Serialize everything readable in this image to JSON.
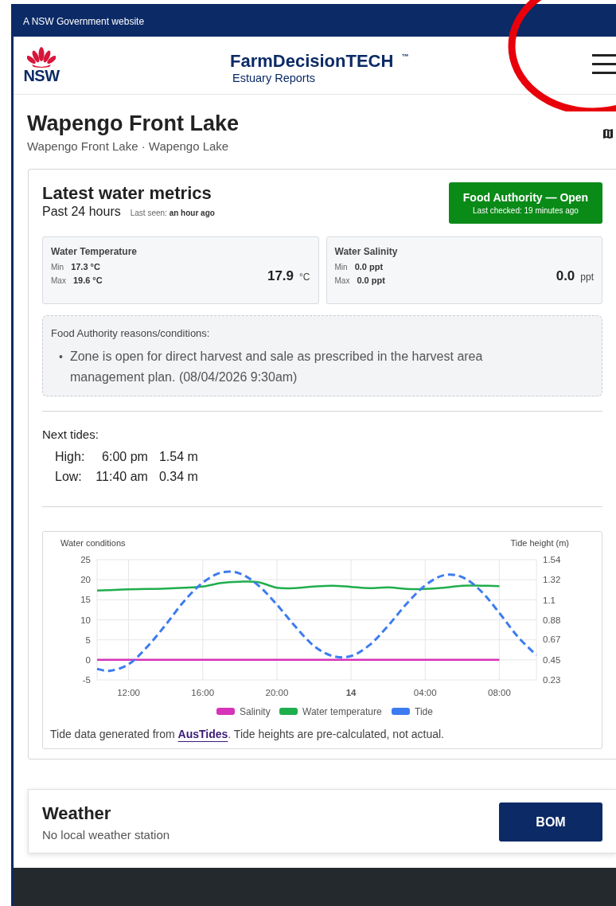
{
  "gov_bar": {
    "text": "A NSW Government website"
  },
  "header": {
    "logo_text": "NSW",
    "title": "FarmDecisionTECH $^{™}$",
    "subtitle": "Estuary Reports"
  },
  "location": {
    "title": "Wapengo Front Lake",
    "subtitle": "Wapengo Front Lake · Wapengo Lake"
  },
  "metrics_card": {
    "title": "Latest water metrics",
    "period": "Past 24 hours",
    "last_seen": "Last seen: **an hour ago**",
    "status": {
      "title": "Food Authority — Open",
      "checked": "Last checked: 19 minutes ago",
      "open": true
    },
    "metrics": [
      {
        "label": "Water Temperature",
        "min_label": "Min",
        "min": "17.3 °C",
        "max_label": "Max",
        "max": "19.6 °C",
        "value": "17.9",
        "unit": "°C"
      },
      {
        "label": "Water Salinity",
        "min_label": "Min",
        "min": "0.0 ppt",
        "max_label": "Max",
        "max": "0.0 ppt",
        "value": "0.0",
        "unit": "ppt"
      }
    ],
    "reasons": {
      "title": "Food Authority reasons/conditions:",
      "bullet": "•",
      "items": [
        "Zone is open for direct harvest and sale as prescribed in the harvest area management plan. (08/04/2026 9:30am)"
      ]
    },
    "tides": {
      "title": "Next tides:",
      "rows": [
        {
          "label": "High:",
          "time": "6:00 pm",
          "height": "1.54 m"
        },
        {
          "label": "Low:",
          "time": "11:40 am",
          "height": "0.34 m"
        }
      ]
    },
    "chart": {
      "chart_data": {
        "type": "line",
        "ylabel": "Water conditions",
        "y2label": "Tide height (m)",
        "x": [
          "2026-04-13T10:18",
          "2026-04-13T11:00",
          "2026-04-13T12:00",
          "2026-04-13T13:00",
          "2026-04-13T14:00",
          "2026-04-13T15:00",
          "2026-04-13T16:00",
          "2026-04-13T17:00",
          "2026-04-13T18:00",
          "2026-04-13T19:00",
          "2026-04-13T20:00",
          "2026-04-13T21:00",
          "2026-04-13T22:00",
          "2026-04-13T23:00",
          "2026-04-14T00:00",
          "2026-04-14T01:00",
          "2026-04-14T02:00",
          "2026-04-14T03:00",
          "2026-04-14T04:00",
          "2026-04-14T05:00",
          "2026-04-14T06:00",
          "2026-04-14T07:00",
          "2026-04-14T08:00",
          "2026-04-14T09:00",
          "2026-04-14T10:00"
        ],
        "xlim": [
          "2026-04-13T10:18",
          "2026-04-14T10:00"
        ],
        "xticks": [
          {
            "value": "2026-04-13T12:00",
            "label": "12:00"
          },
          {
            "value": "2026-04-13T16:00",
            "label": "16:00"
          },
          {
            "value": "2026-04-13T20:00",
            "label": "20:00"
          },
          {
            "value": "2026-04-14T00:00",
            "label": "14"
          },
          {
            "value": "2026-04-14T04:00",
            "label": "04:00"
          },
          {
            "value": "2026-04-14T08:00",
            "label": "08:00"
          }
        ],
        "grid": true,
        "legend": true,
        "ylim": [
          -5,
          25
        ],
        "yticks": [
          -5,
          0,
          5,
          10,
          15,
          20,
          25
        ],
        "y2lim": [
          0.23,
          1.54
        ],
        "y2ticks": [
          0.23,
          0.45,
          0.67,
          0.88,
          1.1,
          1.32,
          1.54
        ],
        "series": [
          {
            "name": "Salinity",
            "color": "#d633b8",
            "line_style": "solid",
            "values": [
              0,
              0,
              0,
              0,
              0,
              0,
              0,
              0,
              0,
              0,
              0,
              0,
              0,
              0,
              0,
              0,
              0,
              0,
              0,
              0,
              0,
              0,
              0,
              null,
              null
            ]
          },
          {
            "name": "Water temperature",
            "color": "#1fae4c",
            "line_style": "solid",
            "values": [
              17.3,
              17.4,
              17.6,
              17.7,
              17.8,
              18.0,
              18.3,
              19.2,
              19.5,
              19.4,
              18.0,
              17.9,
              18.3,
              18.5,
              18.2,
              17.9,
              18.1,
              17.7,
              17.7,
              18.0,
              18.5,
              18.5,
              18.4,
              null,
              null
            ]
          },
          {
            "name": "Tide",
            "color": "#3d7cf0",
            "axis": "y2",
            "line_style": "dashed",
            "values": [
              0.35,
              0.33,
              0.4,
              0.59,
              0.83,
              1.09,
              1.29,
              1.4,
              1.39,
              1.26,
              1.05,
              0.81,
              0.6,
              0.49,
              0.49,
              0.61,
              0.82,
              1.06,
              1.26,
              1.37,
              1.35,
              1.2,
              0.96,
              0.7,
              0.5
            ]
          }
        ]
      },
      "note_prefix": "Tide data generated from ",
      "note_link": "AusTides",
      "note_suffix": ". Tide heights are pre-calculated, not actual."
    }
  },
  "weather": {
    "title": "Weather",
    "subtitle": "No local weather station",
    "button": "BOM"
  }
}
